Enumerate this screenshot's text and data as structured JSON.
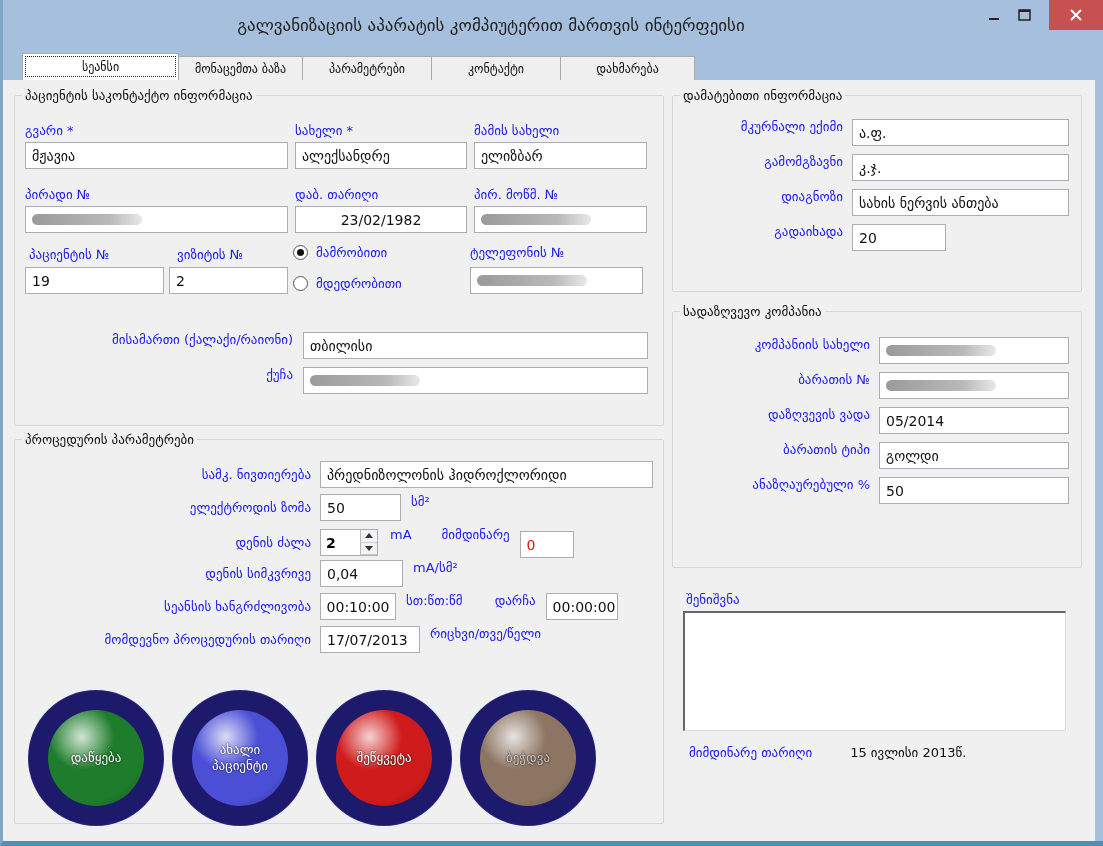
{
  "window": {
    "title": "გალვანიზაციის აპარატის კომპიუტერით მართვის ინტერფეისი"
  },
  "tabs": [
    {
      "label": "სეანსი",
      "selected": true
    },
    {
      "label": "მონაცემთა ბაზა",
      "selected": false
    },
    {
      "label": "პარამეტრები",
      "selected": false
    },
    {
      "label": "კონტაქტი",
      "selected": false
    },
    {
      "label": "დახმარება",
      "selected": false
    }
  ],
  "patient": {
    "title": "პაციენტის საკონტაქტო ინფორმაცია",
    "surname": {
      "label": "გვარი *",
      "value": "მჟავია"
    },
    "first_name": {
      "label": "სახელი *",
      "value": "ალექსანდრე"
    },
    "fathers_name": {
      "label": "მამის სახელი",
      "value": "ელიზბარ"
    },
    "personal_id": {
      "label": "პირადი №",
      "blurred": true
    },
    "birth_date": {
      "label": "დაბ. თარიღი",
      "value": "23/02/1982"
    },
    "id_card": {
      "label": "პირ. მოწმ. №",
      "blurred": true
    },
    "patient_no": {
      "label": "პაციენტის №",
      "value": "19"
    },
    "visit_no": {
      "label": "ვიზიტის  №",
      "value": "2"
    },
    "gender": [
      {
        "label": "მამრობითი",
        "selected": true
      },
      {
        "label": "მდედრობითი",
        "selected": false
      }
    ],
    "phone": {
      "label": "ტელეფონის №",
      "blurred": true
    },
    "city": {
      "label": "მისამართი (ქალაქი/რაიონი)",
      "value": "თბილისი"
    },
    "street": {
      "label": "ქუჩა",
      "blurred": true
    }
  },
  "procedure": {
    "title": "პროცედურის პარამეტრები",
    "substance": {
      "label": "სამკ. ნივთიერება",
      "value": "პრედნიზოლონის ჰიდროქლორიდი"
    },
    "electrode_size": {
      "label": "ელექტროდის ზომა",
      "value": "50",
      "unit": "სმ²"
    },
    "current": {
      "label": "დენის ძალა",
      "value": "2",
      "unit": "mA"
    },
    "present_current": {
      "label": "მიმდინარე",
      "value": "0"
    },
    "density": {
      "label": "დენის სიმკვრივე",
      "value": "0,04",
      "unit": "mA/სმ²"
    },
    "duration": {
      "label": "სეანსის ხანგრძლივობა",
      "value": "00:10:00",
      "unit": "სთ:წთ:წმ"
    },
    "remaining": {
      "label": "დარჩა",
      "value": "00:00:00"
    },
    "next_date": {
      "label": "მომდევნო პროცედურის თარიღი",
      "value": "17/07/2013",
      "unit": "რიცხვი/თვე/წელი"
    }
  },
  "buttons": [
    {
      "label": "დაწყება",
      "color": "#1e7d2c",
      "disabled": false
    },
    {
      "label": "ახალი პაციენტი",
      "color": "#4b4fd6",
      "disabled": false
    },
    {
      "label": "შეწყვეტა",
      "color": "#cf1b1b",
      "disabled": false
    },
    {
      "label": "ბეჭდვა",
      "color": "#8c7563",
      "disabled": true
    }
  ],
  "additional": {
    "title": "დამატებითი ინფორმაცია",
    "fields": [
      {
        "label": "მკურნალი ექიმი",
        "value": "ა.ფ.",
        "kind": "wide"
      },
      {
        "label": "გამომგზავნი",
        "value": "კ.ჯ.",
        "kind": "wide"
      },
      {
        "label": "დიაგნოზი",
        "value": "სახის ნერვის ანთება",
        "kind": "wide"
      },
      {
        "label": "გადაიხადა",
        "value": "20",
        "kind": "short"
      }
    ]
  },
  "insurance": {
    "title": "სადაზღვევო კომპანია",
    "fields": [
      {
        "label": "კომპანიის სახელი",
        "blurred": true
      },
      {
        "label": "ბარათის №",
        "blurred": true
      },
      {
        "label": "დაზღვევის ვადა",
        "value": "05/2014"
      },
      {
        "label": "ბარათის ტიპი",
        "value": "გოლდი"
      },
      {
        "label": "ანაზღაურებული %",
        "value": "50"
      }
    ]
  },
  "note": {
    "label": "შენიშვნა"
  },
  "current_date": {
    "label": "მიმდინარე თარიღი",
    "value": "15 ივლისი 2013წ."
  }
}
